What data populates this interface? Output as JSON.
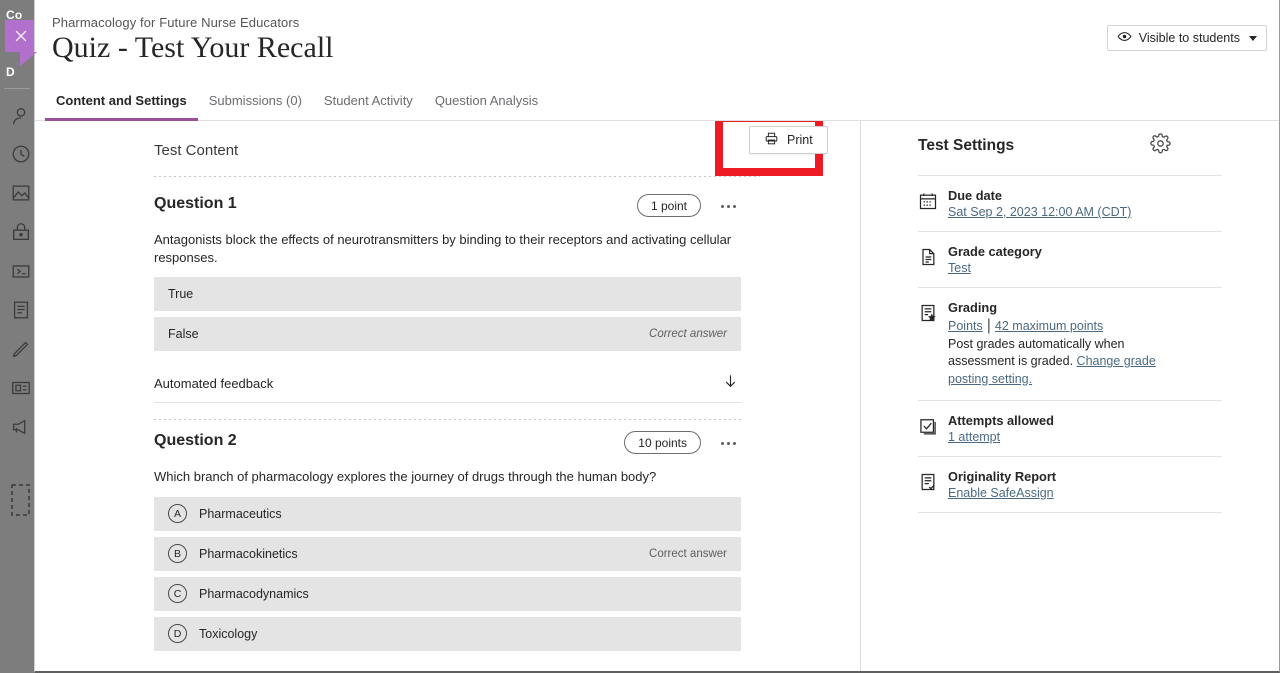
{
  "rail": {
    "items": [
      {
        "name": "courses-label",
        "text": "Co"
      },
      {
        "name": "dashboard-label",
        "text": "D"
      }
    ],
    "icons": [
      "profile-icon",
      "activity-clock-icon",
      "courses-image-icon",
      "organizations-lock-icon",
      "calendar-icon",
      "grades-icon",
      "tools-pencil-icon",
      "content-collection-icon",
      "support-megaphone-icon",
      "collapse-dashed-icon"
    ],
    "close_icon": "close-icon"
  },
  "header": {
    "breadcrumb": "Pharmacology for Future Nurse Educators",
    "title": "Quiz - Test Your Recall",
    "visibility": {
      "icon": "eye-icon",
      "label": "Visible to students",
      "caret": "chevron-down-icon"
    }
  },
  "tabs": [
    {
      "label": "Content and Settings",
      "active": true
    },
    {
      "label": "Submissions (0)",
      "active": false
    },
    {
      "label": "Student Activity",
      "active": false
    },
    {
      "label": "Question Analysis",
      "active": false
    }
  ],
  "content": {
    "section_title": "Test Content",
    "print_button": {
      "icon": "printer-icon",
      "label": "Print"
    },
    "highlight_color": "#ee1b24",
    "questions": [
      {
        "title": "Question 1",
        "points": "1 point",
        "menu_icon": "kebab-menu-icon",
        "prompt": "Antagonists block the effects of neurotransmitters by binding to their receptors and activating cellular responses.",
        "type": "true-false",
        "options": [
          {
            "letter": "",
            "text": "True",
            "correct_label": ""
          },
          {
            "letter": "",
            "text": "False",
            "correct_label": "Correct answer"
          }
        ],
        "automated_feedback": {
          "label": "Automated feedback",
          "icon": "arrow-down-icon"
        }
      },
      {
        "title": "Question 2",
        "points": "10 points",
        "menu_icon": "kebab-menu-icon",
        "prompt": "Which branch of pharmacology explores the journey of drugs through the human body?",
        "type": "multiple-choice",
        "options": [
          {
            "letter": "A",
            "text": "Pharmaceutics",
            "correct_label": ""
          },
          {
            "letter": "B",
            "text": "Pharmacokinetics",
            "correct_label": "Correct answer"
          },
          {
            "letter": "C",
            "text": "Pharmacodynamics",
            "correct_label": ""
          },
          {
            "letter": "D",
            "text": "Toxicology",
            "correct_label": ""
          }
        ]
      }
    ]
  },
  "settings": {
    "title": "Test Settings",
    "gear_icon": "gear-icon",
    "items": [
      {
        "icon": "calendar-icon",
        "label": "Due date",
        "link": "Sat Sep 2, 2023 12:00 AM (CDT)"
      },
      {
        "icon": "document-icon",
        "label": "Grade category",
        "link": "Test"
      },
      {
        "icon": "grading-star-icon",
        "label": "Grading",
        "link": "Points",
        "link2": "42 maximum points",
        "note_prefix": "Post grades automatically when assessment is graded. ",
        "note_link": "Change grade posting setting."
      },
      {
        "icon": "checkbox-icon",
        "label": "Attempts allowed",
        "link": "1 attempt"
      },
      {
        "icon": "report-check-icon",
        "label": "Originality Report",
        "link": "Enable SafeAssign"
      }
    ]
  },
  "accent": "#9b4f96"
}
